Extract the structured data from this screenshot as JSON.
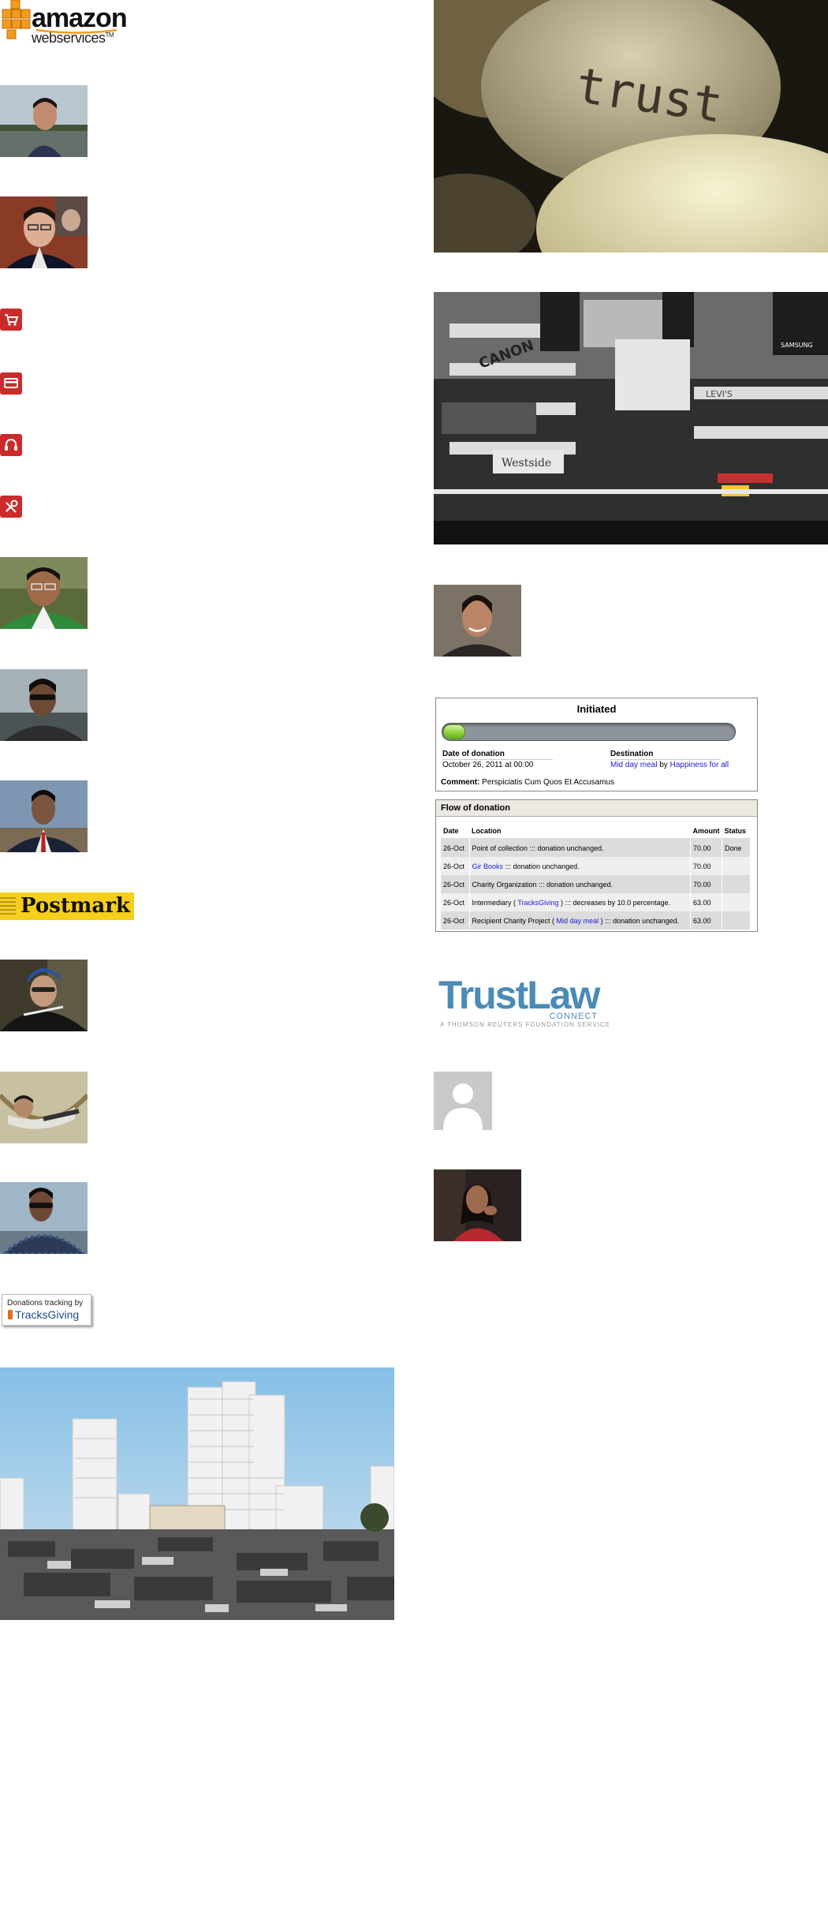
{
  "amazon_logo": {
    "word": "amazon",
    "sub": "webservices",
    "tm": "TM"
  },
  "trust_image": {
    "word": "trust"
  },
  "mall_banners": [
    "CANON",
    "SAMSUNG",
    "Westside",
    "LEVI'S"
  ],
  "postmark_logo": {
    "text": "Postmark"
  },
  "tracksgiving_badge": {
    "line1": "Donations tracking by",
    "line2": "TracksGiving"
  },
  "trustlaw_logo": {
    "main": "TrustLaw",
    "sub": "CONNECT",
    "tagline": "A THOMSON REUTERS FOUNDATION SERVICE"
  },
  "donation_status": {
    "title": "Initiated",
    "progress": 0.08,
    "date_label": "Date of donation",
    "date_value": "October 26, 2011 at 00:00",
    "destination_label": "Destination",
    "destination_project": "Mid day meal",
    "destination_by": "by",
    "destination_org": "Happiness for all",
    "comment_label": "Comment:",
    "comment_value": "Perspiciatis Cum Quos Et Accusamus"
  },
  "flow": {
    "title": "Flow of donation",
    "columns": [
      "Date",
      "Location",
      "Amount",
      "Status"
    ],
    "rows": [
      {
        "date": "26-Oct",
        "pre": "Point of collection",
        "link": "",
        "post": " ::: donation unchanged.",
        "amount": "70.00",
        "status": "Done"
      },
      {
        "date": "26-Oct",
        "pre": "",
        "link": "Gir Books",
        "post": " ::: donation unchanged.",
        "amount": "70.00",
        "status": ""
      },
      {
        "date": "26-Oct",
        "pre": "Charity Organization",
        "link": "",
        "post": " ::: donation unchanged.",
        "amount": "70.00",
        "status": ""
      },
      {
        "date": "26-Oct",
        "pre": "Intermediary ( ",
        "link": "TracksGiving",
        "post": " ) ::: decreases by 10.0 percentage.",
        "amount": "63.00",
        "status": ""
      },
      {
        "date": "26-Oct",
        "pre": "Recipient Charity Project ( ",
        "link": "Mid day meal",
        "post": " ) ::: donation unchanged.",
        "amount": "63.00",
        "status": ""
      }
    ]
  },
  "icons": [
    "cart-icon",
    "card-icon",
    "headset-icon",
    "tools-icon"
  ]
}
